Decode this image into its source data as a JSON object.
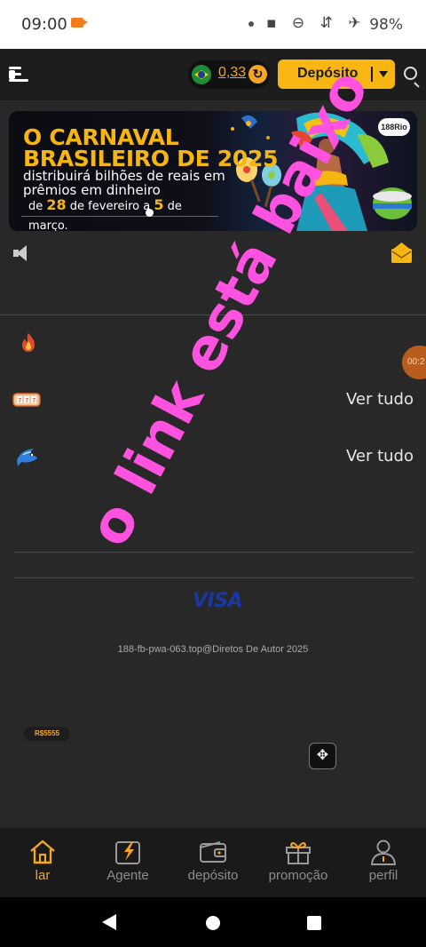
{
  "status_bar": {
    "time": "09:00",
    "system_icons": "▪ ⊖ ⇵ ✈",
    "battery": "98%"
  },
  "header": {
    "balance": "0,33",
    "deposit_label": "Depósito"
  },
  "banner": {
    "title_line1": "O CARNAVAL",
    "title_line2": "BRASILEIRO DE 2025",
    "subtitle_line1": "distribuirá bilhões de reais em",
    "subtitle_line2": "prêmios em dinheiro",
    "dates_prefix": "de",
    "date_start": "28",
    "dates_mid": "de fevereiro a",
    "date_end": "5",
    "dates_suffix": "de março.",
    "logo_text": "188Rio"
  },
  "sections": {
    "see_all_1": "Ver tudo",
    "see_all_2": "Ver tudo"
  },
  "float_timer": "00:2",
  "overlay_text": "o link está baixo",
  "footer": {
    "payment_logo": "VISA",
    "copyright": "188-fb-pwa-063.top@Diretos De Autor 2025",
    "chip": "R$5555"
  },
  "bottom_nav": {
    "items": [
      {
        "label": "lar",
        "icon": "home-icon",
        "active": true
      },
      {
        "label": "Agente",
        "icon": "agent-icon",
        "active": false
      },
      {
        "label": "depósito",
        "icon": "wallet-icon",
        "active": false
      },
      {
        "label": "promoção",
        "icon": "gift-icon",
        "active": false
      },
      {
        "label": "perfil",
        "icon": "profile-icon",
        "active": false
      }
    ]
  },
  "colors": {
    "accent": "#f9b612",
    "background": "#282828",
    "overlay": "#ff52e0"
  }
}
